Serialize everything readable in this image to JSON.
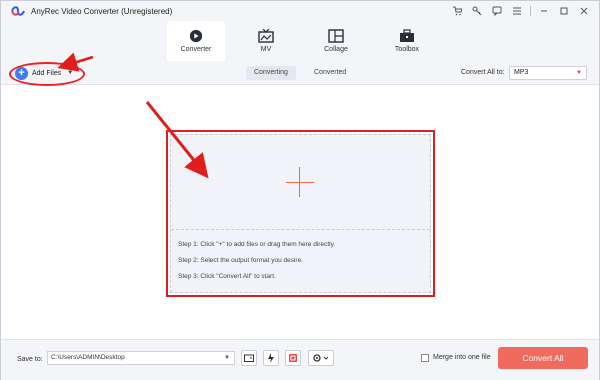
{
  "titlebar": {
    "title": "AnyRec Video Converter (Unregistered)",
    "icons": [
      "cart-icon",
      "key-icon",
      "feedback-icon",
      "menu-icon",
      "minimize-icon",
      "maximize-icon",
      "close-icon"
    ]
  },
  "nav": {
    "tabs": [
      {
        "label": "Converter",
        "icon": "converter-icon",
        "active": true
      },
      {
        "label": "MV",
        "icon": "mv-icon",
        "active": false
      },
      {
        "label": "Collage",
        "icon": "collage-icon",
        "active": false
      },
      {
        "label": "Toolbox",
        "icon": "toolbox-icon",
        "active": false
      }
    ]
  },
  "toolbar": {
    "add_files": "Add Files",
    "segments": [
      "Converting",
      "Converted"
    ],
    "active_segment": "Converting",
    "convert_all_to_label": "Convert All to:",
    "format_value": "MP3"
  },
  "dropzone": {
    "steps": [
      "Step 1: Click \"+\" to add files or drag them here directly.",
      "Step 2: Select the output format you desire.",
      "Step 3: Click \"Convert All\" to start."
    ]
  },
  "bottombar": {
    "save_to_label": "Save to:",
    "path_value": "C:\\Users\\ADMIN\\Desktop",
    "merge_label": "Merge into one file",
    "merge_checked": false,
    "convert_all_button": "Convert All"
  },
  "colors": {
    "accent_blue": "#3d7cf2",
    "accent_red": "#f06a5e",
    "annotation_red": "#e01e1e",
    "chrome_bg": "#f4f5f9"
  }
}
